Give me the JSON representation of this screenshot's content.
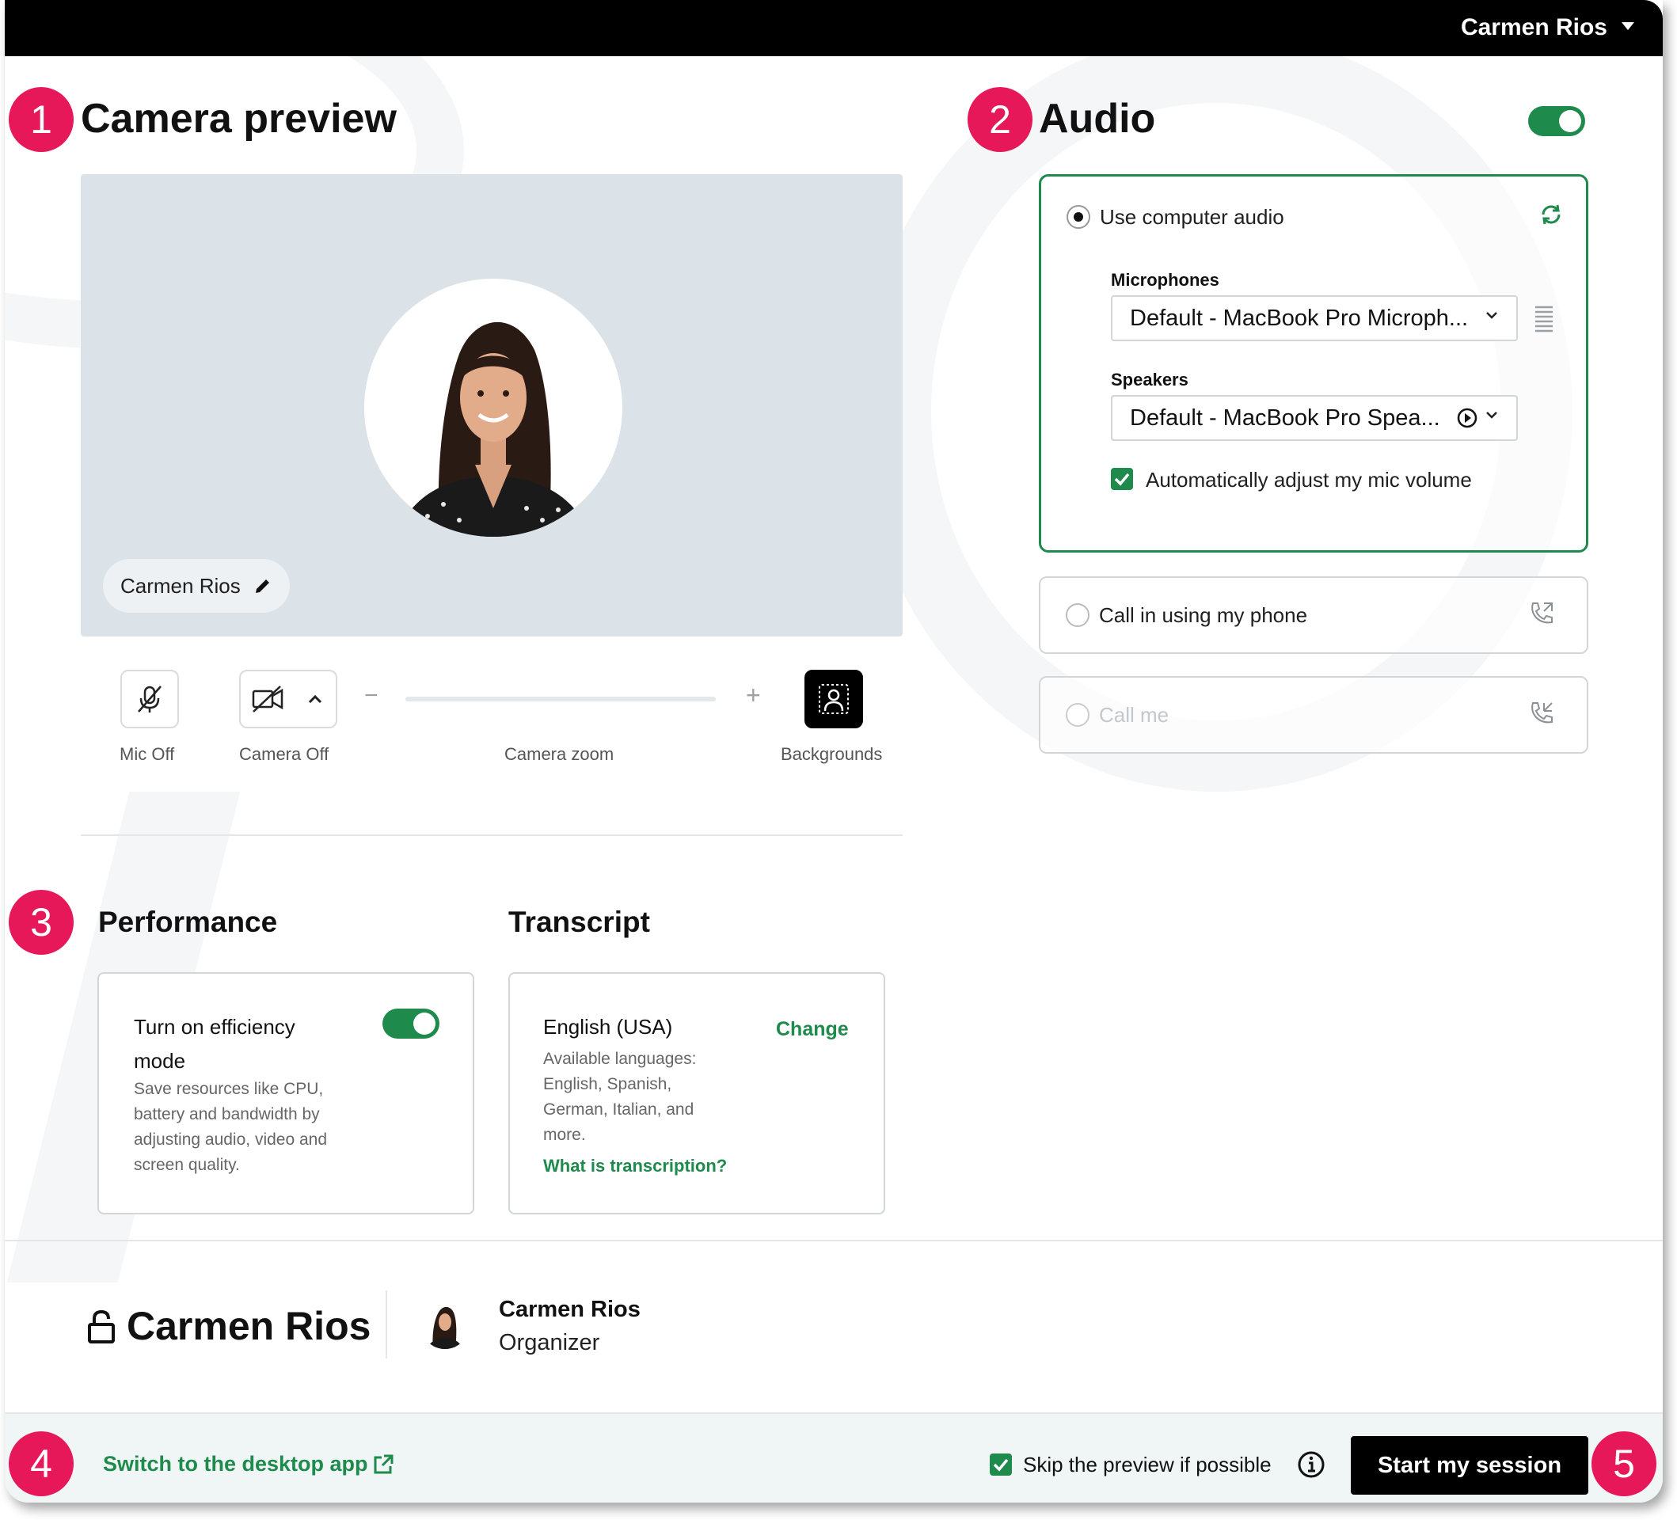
{
  "topbar": {
    "user_name": "Carmen Rios"
  },
  "steps": {
    "s1": "1",
    "s2": "2",
    "s3": "3",
    "s4": "4",
    "s5": "5"
  },
  "camera": {
    "title": "Camera preview",
    "name_chip": "Carmen Rios",
    "mic_label": "Mic Off",
    "camera_label": "Camera Off",
    "zoom_label": "Camera zoom",
    "zoom_minus": "−",
    "zoom_plus": "+",
    "backgrounds_label": "Backgrounds"
  },
  "audio": {
    "title": "Audio",
    "enabled": true,
    "computer_audio_label": "Use computer audio",
    "microphones_label": "Microphones",
    "microphone_value": "Default - MacBook Pro Microph...",
    "speakers_label": "Speakers",
    "speaker_value": "Default - MacBook Pro Spea...",
    "auto_adjust_label": "Automatically adjust my mic volume",
    "auto_adjust_checked": true,
    "call_in_label": "Call in using my phone",
    "call_me_label": "Call me"
  },
  "performance": {
    "title": "Performance",
    "efficiency_line1": "Turn on efficiency",
    "efficiency_line2": "mode",
    "efficiency_on": true,
    "desc1": "Save resources like CPU,",
    "desc2": "battery and bandwidth by",
    "desc3": "adjusting audio, video and",
    "desc4": "screen quality."
  },
  "transcript": {
    "title": "Transcript",
    "language": "English (USA)",
    "change_label": "Change",
    "avail1": "Available languages:",
    "avail2": "English, Spanish,",
    "avail3": "German, Italian, and",
    "avail4": "more.",
    "what_link": "What is transcription?"
  },
  "host": {
    "room_name": "Carmen Rios",
    "organizer_name": "Carmen Rios",
    "organizer_role": "Organizer"
  },
  "footer": {
    "desktop_link": "Switch to the desktop app",
    "skip_label": "Skip the preview if possible",
    "skip_checked": true,
    "start_label": "Start my session"
  },
  "colors": {
    "accent": "#1e8a4c",
    "badge": "#e6185a",
    "preview_bg": "#dbe2e8"
  }
}
